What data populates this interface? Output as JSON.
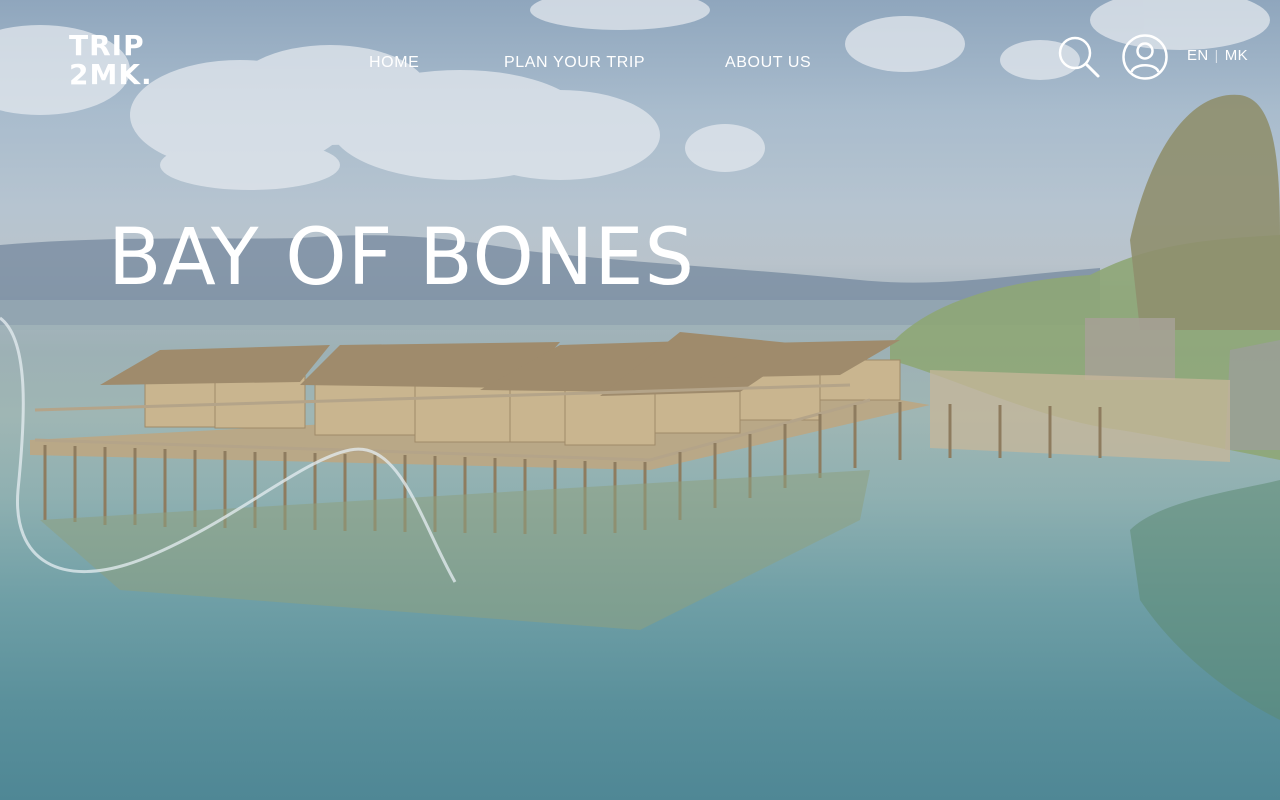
{
  "header": {
    "logo_text": "TRIP\n2MK.",
    "nav": [
      {
        "label": "HOME"
      },
      {
        "label": "PLAN YOUR TRIP"
      },
      {
        "label": "ABOUT US"
      }
    ],
    "search_icon": "search-icon",
    "account_icon": "user-circle-icon",
    "languages": [
      "EN",
      "MK"
    ],
    "language_separator": "|"
  },
  "hero": {
    "title": "BAY OF BONES",
    "image_subject": "pile-dwelling museum on the lake"
  },
  "colors": {
    "text": "#ffffff",
    "sky": "#a9bccd",
    "water": "#5a909b"
  }
}
